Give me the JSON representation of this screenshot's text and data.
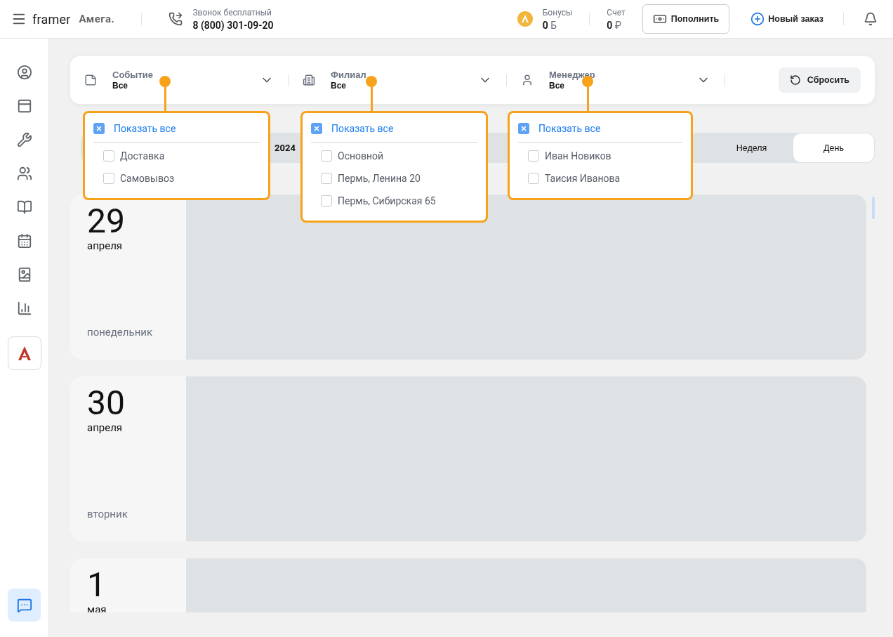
{
  "header": {
    "brand": "framer",
    "logo_text": "Амега.",
    "call": {
      "label": "Звонок бесплатный",
      "phone": "8 (800) 301-09-20"
    },
    "bonuses": {
      "label": "Бонусы",
      "value": "0",
      "unit": "Б"
    },
    "account": {
      "label": "Счет",
      "value": "0",
      "unit": "₽"
    },
    "topup_button": "Пополнить",
    "new_order_button": "Новый заказ"
  },
  "filters": [
    {
      "kind": "event",
      "label": "Событие",
      "value": "Все"
    },
    {
      "kind": "branch",
      "label": "Филиал",
      "value": "Все"
    },
    {
      "kind": "manager",
      "label": "Менеджер",
      "value": "Все"
    }
  ],
  "reset_button": "Сбросить",
  "filter_dropdowns": [
    {
      "show_all": {
        "label": "Показать все",
        "checked": true
      },
      "options": [
        {
          "label": "Доставка",
          "checked": false
        },
        {
          "label": "Самовывоз",
          "checked": false
        }
      ]
    },
    {
      "show_all": {
        "label": "Показать все",
        "checked": true
      },
      "options": [
        {
          "label": "Основной",
          "checked": false
        },
        {
          "label": "Пермь, Ленина 20",
          "checked": false
        },
        {
          "label": "Пермь, Сибирская 65",
          "checked": false
        }
      ]
    },
    {
      "show_all": {
        "label": "Показать все",
        "checked": true
      },
      "options": [
        {
          "label": "Иван Новиков",
          "checked": false
        },
        {
          "label": "Таисия Иванова",
          "checked": false
        }
      ]
    }
  ],
  "view_bar": {
    "date_text": "2024",
    "tabs": [
      {
        "label": "Неделя",
        "selected": false
      },
      {
        "label": "День",
        "selected": true
      }
    ]
  },
  "days": [
    {
      "day": "29",
      "month": "апреля",
      "weekday": "понедельник"
    },
    {
      "day": "30",
      "month": "апреля",
      "weekday": "вторник"
    },
    {
      "day": "1",
      "month": "мая"
    }
  ]
}
